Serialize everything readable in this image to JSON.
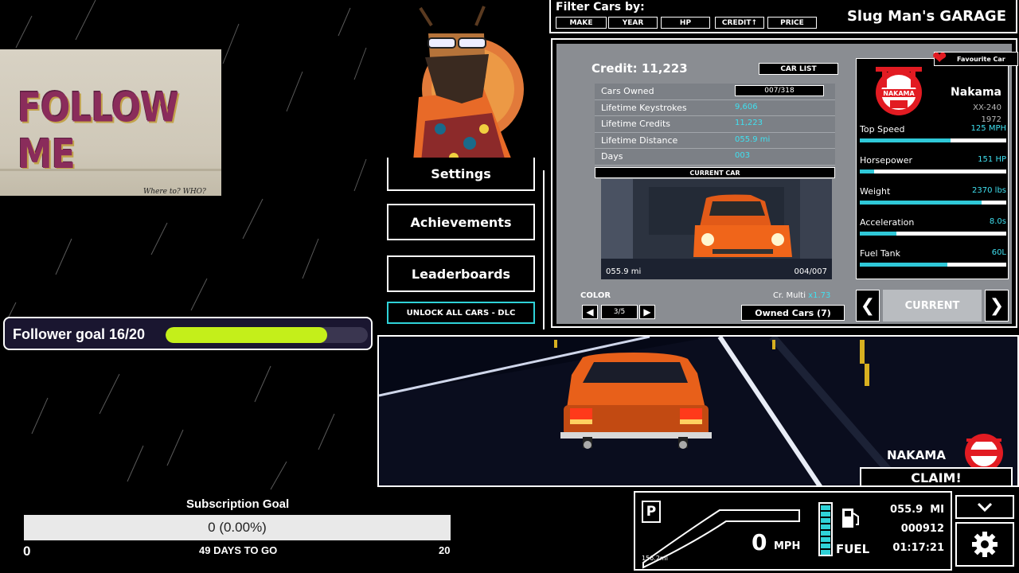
{
  "overlay": {
    "follower_goal": {
      "label": "Follower goal 16/20",
      "current": 16,
      "target": 20
    },
    "photo": {
      "graffiti": "FOLLOW ME",
      "scribble": "Where to? WHO?"
    },
    "subscription": {
      "title": "Subscription Goal",
      "value_text": "0 (0.00%)",
      "min": "0",
      "max": "20",
      "days": "49 DAYS TO GO",
      "progress": 0.0
    }
  },
  "menu": {
    "settings_label": "Settings",
    "achievements_label": "Achievements",
    "leaderboards_label": "Leaderboards",
    "dlc_label": "UNLOCK ALL CARS - DLC"
  },
  "filter": {
    "title": "Filter Cars by:",
    "buttons": [
      "MAKE",
      "YEAR",
      "HP",
      "CREDIT↑",
      "PRICE"
    ],
    "garage_title": "Slug Man's GARAGE"
  },
  "garage": {
    "credit": "Credit: 11,223",
    "car_list_label": "CAR LIST",
    "stats": [
      {
        "label": "Cars Owned",
        "value": "007/318",
        "boxed": true
      },
      {
        "label": "Lifetime Keystrokes",
        "value": "9,606"
      },
      {
        "label": "Lifetime Credits",
        "value": "11,223"
      },
      {
        "label": "Lifetime Distance",
        "value": "055.9 mi"
      },
      {
        "label": "Days",
        "value": "003"
      }
    ],
    "current_car_label": "CURRENT CAR",
    "car_miles": "055.9 mi",
    "car_count": "004/007",
    "color_label": "COLOR",
    "color_count": "3/5",
    "cr_multi_label": "Cr. Multi",
    "cr_multi_value": "x1.73",
    "owned_cars_label": "Owned Cars (7)",
    "favourite_label": "Favourite Car",
    "brand": "Nakama",
    "model": "XX-240",
    "year": "1972",
    "specs": [
      {
        "label": "Top Speed",
        "value": "125 MPH",
        "level": 0.62
      },
      {
        "label": "Horsepower",
        "value": "151 HP",
        "level": 0.1
      },
      {
        "label": "Weight",
        "value": "2370 lbs",
        "level": 0.83
      },
      {
        "label": "Acceleration",
        "value": "8.0s",
        "level": 0.25
      },
      {
        "label": "Fuel Tank",
        "value": "60L",
        "level": 0.6
      }
    ],
    "nav_current_label": "CURRENT",
    "logo_text": "NAKAMA"
  },
  "road": {
    "brand_label": "NAKAMA",
    "claim_label": "CLAIM!"
  },
  "dashboard": {
    "gear": "P",
    "speed": "0",
    "speed_unit": "MPH",
    "small_distance": "156.2mi",
    "fuel_label": "FUEL",
    "odometer": "055.9",
    "odometer_unit": "MI",
    "keystrokes": "000912",
    "time": "01:17:21"
  },
  "colors": {
    "accent": "#2fd2d8",
    "follower_fill": "#c4ef1a",
    "car_orange": "#f0651a",
    "heart": "#e21b22"
  }
}
